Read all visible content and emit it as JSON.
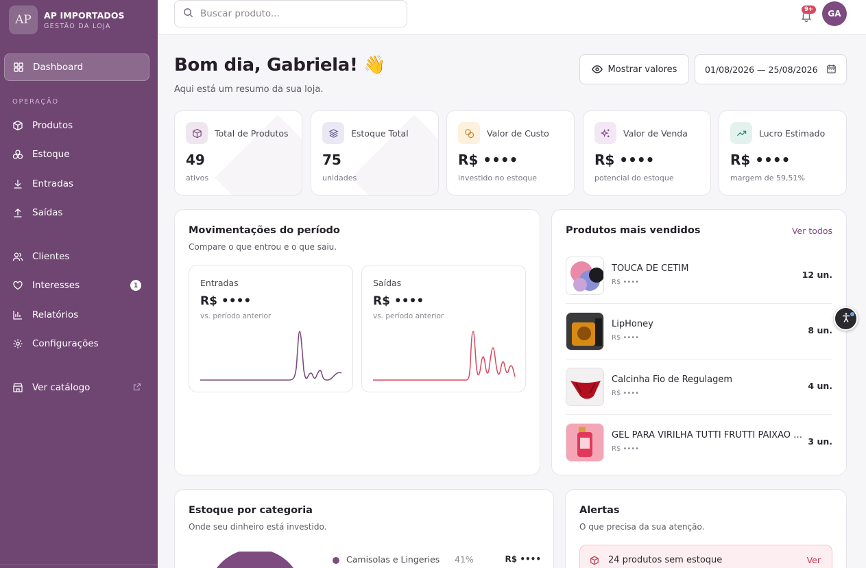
{
  "brand": {
    "logo_text": "AP",
    "name": "AP IMPORTADOS",
    "subtitle": "GESTÃO DA LOJA"
  },
  "sidebar": {
    "dashboard": "Dashboard",
    "section_operacao": "OPERAÇÃO",
    "produtos": "Produtos",
    "estoque": "Estoque",
    "entradas": "Entradas",
    "saidas": "Saídas",
    "clientes": "Clientes",
    "interesses": "Interesses",
    "interesses_badge": "1",
    "relatorios": "Relatórios",
    "configuracoes": "Configurações",
    "ver_catalogo": "Ver catálogo"
  },
  "topbar": {
    "search_placeholder": "Buscar produto...",
    "notif_badge": "9+",
    "avatar_initials": "GA"
  },
  "header": {
    "greeting": "Bom dia, Gabriela! 👋",
    "subtitle": "Aqui está um resumo da sua loja.",
    "show_values_label": "Mostrar valores",
    "date_range": "01/08/2026 — 25/08/2026"
  },
  "kpis": [
    {
      "label": "Total de Produtos",
      "value": "49",
      "sub": "ativos"
    },
    {
      "label": "Estoque Total",
      "value": "75",
      "sub": "unidades"
    },
    {
      "label": "Valor de Custo",
      "value": "R$ ••••",
      "sub": "investido no estoque"
    },
    {
      "label": "Valor de Venda",
      "value": "R$ ••••",
      "sub": "potencial do estoque"
    },
    {
      "label": "Lucro Estimado",
      "value": "R$ ••••",
      "sub": "margem de 59,51%"
    }
  ],
  "movements": {
    "title": "Movimentações do período",
    "subtitle": "Compare o que entrou e o que saiu.",
    "entradas": {
      "label": "Entradas",
      "value": "R$ ••••",
      "sub": "vs. período anterior"
    },
    "saidas": {
      "label": "Saídas",
      "value": "R$ ••••",
      "sub": "vs. período anterior"
    }
  },
  "top_products": {
    "title": "Produtos mais vendidos",
    "see_all": "Ver todos",
    "items": [
      {
        "name": "TOUCA DE CETIM",
        "price": "R$ ••••",
        "qty": "12 un."
      },
      {
        "name": "LipHoney",
        "price": "R$ ••••",
        "qty": "8 un."
      },
      {
        "name": "Calcinha Fio de Regulagem",
        "price": "R$ ••••",
        "qty": "4 un."
      },
      {
        "name": "GEL PARA VIRILHA TUTTI FRUTTI PAIXÃO 25...",
        "price": "R$ ••••",
        "qty": "3 un."
      }
    ]
  },
  "stock_category": {
    "title": "Estoque por categoria",
    "subtitle": "Onde seu dinheiro está investido.",
    "legend": [
      {
        "name": "Camisolas e Lingeries",
        "pct": "41%",
        "value": "R$ ••••"
      }
    ]
  },
  "alerts": {
    "title": "Alertas",
    "subtitle": "O que precisa da sua atenção.",
    "items": [
      {
        "text": "24 produtos sem estoque",
        "link": "Ver"
      }
    ]
  },
  "colors": {
    "sidebar": "#6f4672",
    "accent": "#7d4b80",
    "alert": "#c53a52"
  }
}
